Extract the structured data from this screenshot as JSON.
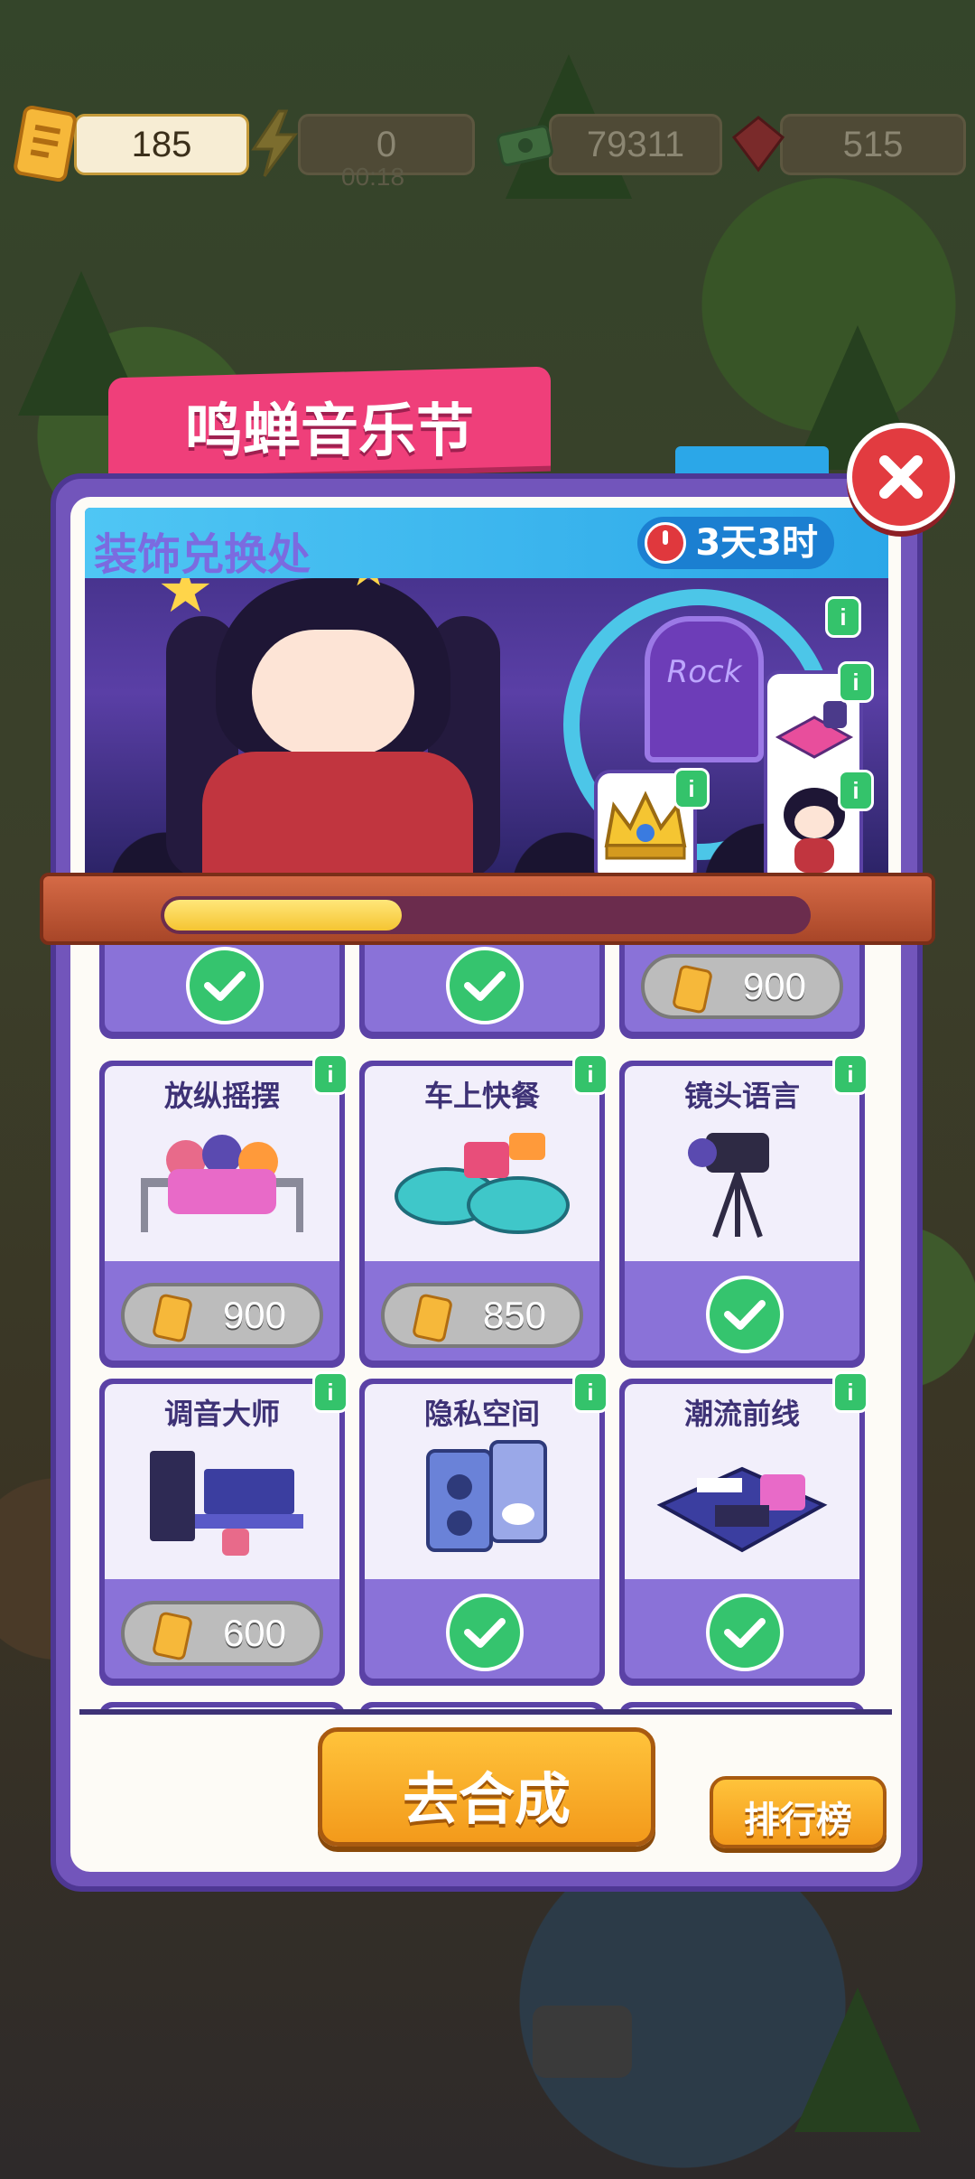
{
  "currencies": [
    {
      "name": "ticket",
      "value": "185",
      "icon": "ticket-icon"
    },
    {
      "name": "energy",
      "value": "0",
      "icon": "lightning-icon",
      "timer": "00:18"
    },
    {
      "name": "cash",
      "value": "79311",
      "icon": "cash-icon"
    },
    {
      "name": "gem",
      "value": "515",
      "icon": "ruby-icon"
    }
  ],
  "event": {
    "title": "鸣蝉音乐节",
    "banner_title": "装饰兑换处",
    "time_left": "3天3时",
    "stage_sign": "Rock",
    "progress": 0.37
  },
  "items": [
    {
      "name": "",
      "status": "owned"
    },
    {
      "name": "",
      "status": "owned"
    },
    {
      "name": "",
      "status": "price",
      "price": "900"
    },
    {
      "name": "放纵摇摆",
      "status": "price",
      "price": "900"
    },
    {
      "name": "车上快餐",
      "status": "price",
      "price": "850"
    },
    {
      "name": "镜头语言",
      "status": "owned"
    },
    {
      "name": "调音大师",
      "status": "price",
      "price": "600"
    },
    {
      "name": "隐私空间",
      "status": "owned"
    },
    {
      "name": "潮流前线",
      "status": "owned"
    }
  ],
  "info_label": "i",
  "buttons": {
    "go_merge": "去合成",
    "leaderboard": "排行榜"
  },
  "colors": {
    "accent_pink": "#ef3f7a",
    "panel_purple": "#7255bb",
    "check_green": "#35c46e",
    "button_orange": "#f39a1b"
  }
}
